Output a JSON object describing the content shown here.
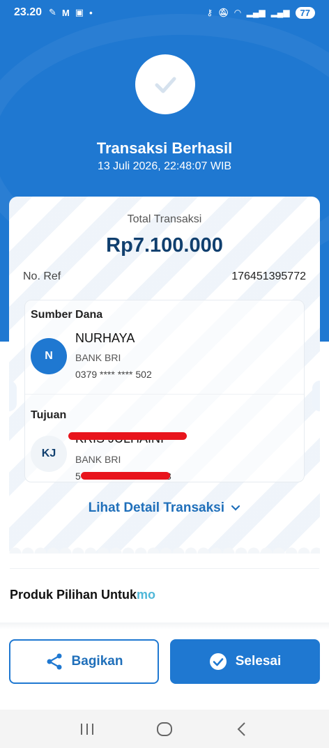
{
  "status_bar": {
    "time": "23.20",
    "left_icons": [
      "notification-icon",
      "gmail-icon",
      "news-icon",
      "dot-icon"
    ],
    "right_icons": [
      "key-icon",
      "mute-icon",
      "wifi-icon",
      "signal-icon",
      "signal-icon"
    ],
    "battery": "77"
  },
  "header": {
    "title": "Transaksi Berhasil",
    "datetime": "13 Juli 2026, 22:48:07 WIB"
  },
  "receipt": {
    "total_label": "Total Transaksi",
    "total_amount": "Rp7.100.000",
    "ref_label": "No. Ref",
    "ref_value": "176451395772",
    "source": {
      "label": "Sumber Dana",
      "initials": "N",
      "name": "NURHAYA",
      "bank": "BANK BRI",
      "account": "0379 **** **** 502"
    },
    "destination": {
      "label": "Tujuan",
      "initials": "KJ",
      "name": "KRIS JULHAINI",
      "bank": "BANK BRI",
      "account_start": "5",
      "account_end": "3"
    },
    "detail_link": "Lihat Detail Transaksi"
  },
  "promo": {
    "label": "Produk Pilihan Untuk",
    "brand": "mo"
  },
  "actions": {
    "share_label": "Bagikan",
    "done_label": "Selesai"
  },
  "colors": {
    "primary": "#1f78d1",
    "amount": "#103f6e",
    "redaction": "#e8141c"
  }
}
